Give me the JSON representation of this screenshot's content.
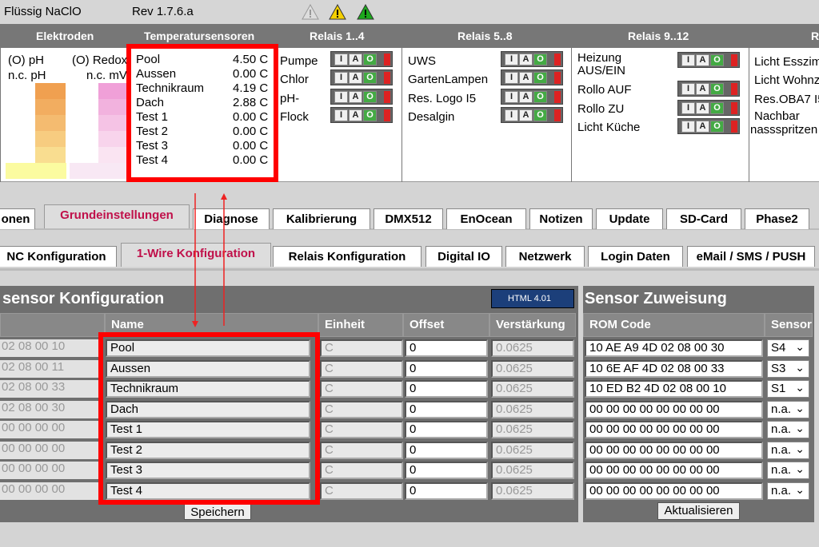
{
  "app": {
    "title": "Flüssig NaClO",
    "revision": "Rev 1.7.6.a"
  },
  "status_icons": [
    "gray-warning-icon",
    "yellow-warning-icon",
    "green-warning-icon"
  ],
  "header_columns": [
    "Elektroden",
    "Temperatursensoren",
    "Relais 1..4",
    "Relais 5..8",
    "Relais 9..12",
    "R"
  ],
  "elektroden": {
    "ph_label": "(O) pH",
    "ph_value": "n.c. pH",
    "redox_label": "(O) Redox",
    "redox_value": "n.c. mV"
  },
  "temps": [
    {
      "name": "Pool",
      "value": "4.50 C"
    },
    {
      "name": "Aussen",
      "value": "0.00 C"
    },
    {
      "name": "Technikraum",
      "value": "4.19 C"
    },
    {
      "name": "Dach",
      "value": "2.88 C"
    },
    {
      "name": "Test 1",
      "value": "0.00 C"
    },
    {
      "name": "Test 2",
      "value": "0.00 C"
    },
    {
      "name": "Test 3",
      "value": "0.00 C"
    },
    {
      "name": "Test 4",
      "value": "0.00 C"
    }
  ],
  "relais_1_4": [
    "Pumpe",
    "Chlor",
    "pH-",
    "Flock"
  ],
  "relais_5_8": [
    "UWS",
    "GartenLampen",
    "Res. Logo I5",
    "Desalgin"
  ],
  "relais_9_12": [
    "Heizung AUS/EIN",
    "Rollo AUF",
    "Rollo ZU",
    "Licht Küche"
  ],
  "relais_13": [
    "Licht Esszim",
    "Licht Wohnz",
    "Res.OBA7 I5",
    "Nachbar",
    "nassspritzen"
  ],
  "relay_button_letters": [
    "I",
    "A",
    "O"
  ],
  "main_tabs": [
    "onen",
    "Grundeinstellungen",
    "Diagnose",
    "Kalibrierung",
    "DMX512",
    "EnOcean",
    "Notizen",
    "Update",
    "SD-Card",
    "Phase2"
  ],
  "sub_tabs": [
    "NC Konfiguration",
    "1-Wire Konfiguration",
    "Relais Konfiguration",
    "Digital IO",
    "Netzwerk",
    "Login Daten",
    "eMail / SMS / PUSH"
  ],
  "sensor_config": {
    "title": "sensor Konfiguration",
    "badge": "HTML 4.01",
    "headers": {
      "name": "Name",
      "einheit": "Einheit",
      "offset": "Offset",
      "verstaerkung": "Verstärkung"
    },
    "rows": [
      {
        "rom": "02 08 00 10",
        "name": "Pool",
        "einheit": "C",
        "offset": "0",
        "gain": "0.0625"
      },
      {
        "rom": "02 08 00 11",
        "name": "Aussen",
        "einheit": "C",
        "offset": "0",
        "gain": "0.0625"
      },
      {
        "rom": "02 08 00 33",
        "name": "Technikraum",
        "einheit": "C",
        "offset": "0",
        "gain": "0.0625"
      },
      {
        "rom": "02 08 00 30",
        "name": "Dach",
        "einheit": "C",
        "offset": "0",
        "gain": "0.0625"
      },
      {
        "rom": "00 00 00 00",
        "name": "Test 1",
        "einheit": "C",
        "offset": "0",
        "gain": "0.0625"
      },
      {
        "rom": "00 00 00 00",
        "name": "Test 2",
        "einheit": "C",
        "offset": "0",
        "gain": "0.0625"
      },
      {
        "rom": "00 00 00 00",
        "name": "Test 3",
        "einheit": "C",
        "offset": "0",
        "gain": "0.0625"
      },
      {
        "rom": "00 00 00 00",
        "name": "Test 4",
        "einheit": "C",
        "offset": "0",
        "gain": "0.0625"
      }
    ],
    "save_label": "Speichern"
  },
  "sensor_assign": {
    "title": "Sensor Zuweisung",
    "headers": {
      "rom": "ROM Code",
      "sensor": "Sensor"
    },
    "rows": [
      {
        "rom": "10 AE A9 4D 02 08 00 30",
        "sensor": "S4"
      },
      {
        "rom": "10 6E AF 4D 02 08 00 33",
        "sensor": "S3"
      },
      {
        "rom": "10 ED B2 4D 02 08 00 10",
        "sensor": "S1"
      },
      {
        "rom": "00 00 00 00 00 00 00 00",
        "sensor": "n.a."
      },
      {
        "rom": "00 00 00 00 00 00 00 00",
        "sensor": "n.a."
      },
      {
        "rom": "00 00 00 00 00 00 00 00",
        "sensor": "n.a."
      },
      {
        "rom": "00 00 00 00 00 00 00 00",
        "sensor": "n.a."
      },
      {
        "rom": "00 00 00 00 00 00 00 00",
        "sensor": "n.a."
      }
    ],
    "refresh_label": "Aktualisieren"
  },
  "colors": {
    "accent": "#c0104a",
    "highlight": "#ff0000",
    "header_bg": "#777777"
  }
}
